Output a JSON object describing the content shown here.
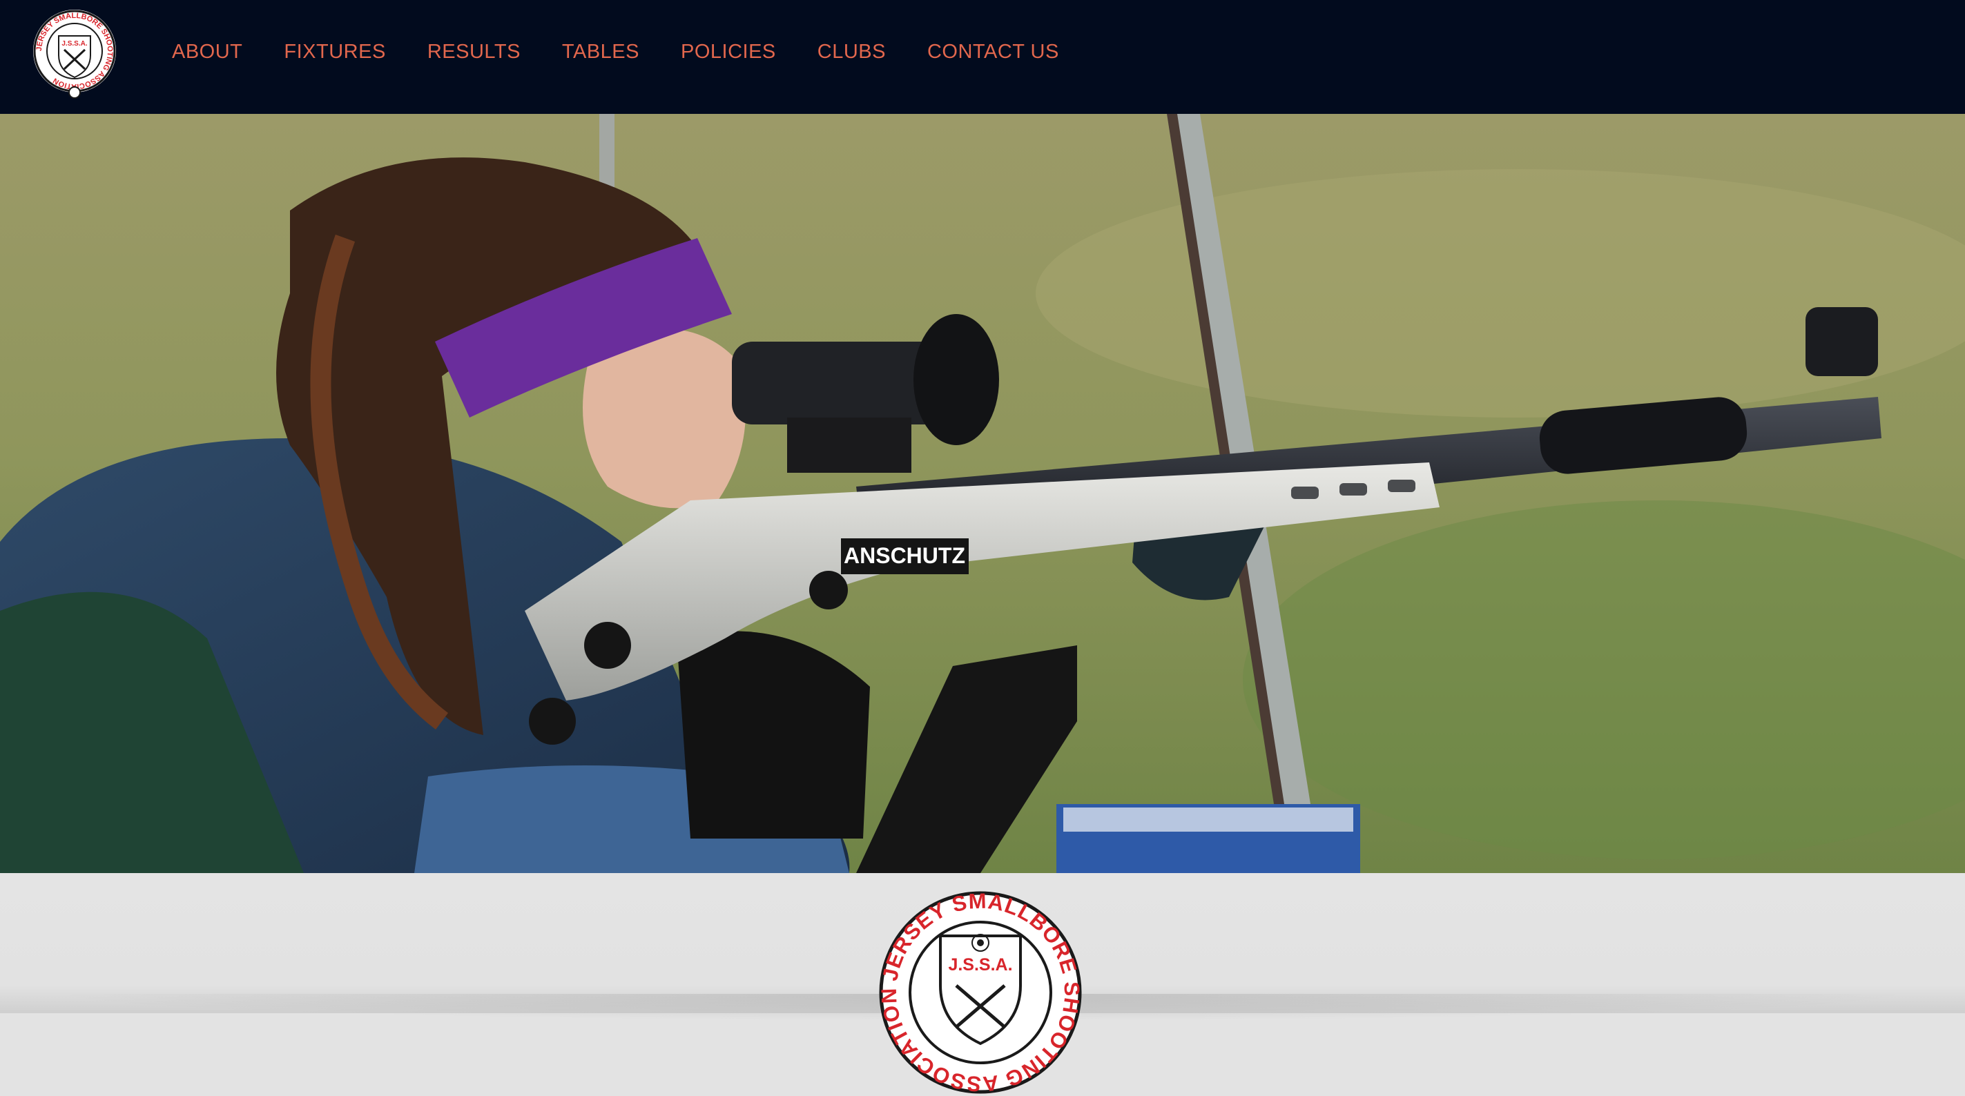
{
  "nav": {
    "logo_text": "J.S.S.A.",
    "logo_ring_text": "JERSEY SMALLBORE SHOOTING ASSOCIATION",
    "items": [
      {
        "label": "ABOUT"
      },
      {
        "label": "FIXTURES"
      },
      {
        "label": "RESULTS"
      },
      {
        "label": "TABLES"
      },
      {
        "label": "POLICIES"
      },
      {
        "label": "CLUBS"
      },
      {
        "label": "CONTACT US"
      }
    ]
  },
  "hero": {
    "rifle_brand": "ANSCHUTZ"
  },
  "footer": {
    "logo_text": "J.S.S.A.",
    "logo_ring_text": "JERSEY SMALLBORE SHOOTING ASSOCIATION"
  },
  "colors": {
    "nav_bg": "#020b1e",
    "nav_link": "#e2674d",
    "footer_bg": "#e3e3e3",
    "logo_red": "#d8252b"
  }
}
